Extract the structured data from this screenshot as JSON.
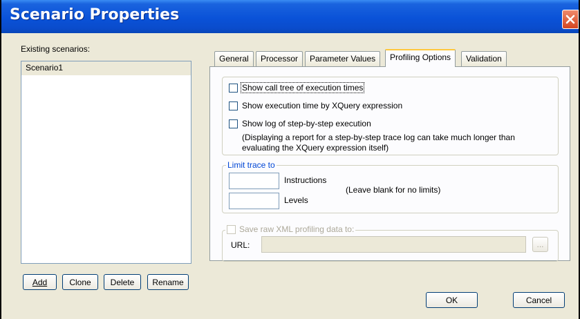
{
  "window": {
    "title": "Scenario Properties"
  },
  "scenarios": {
    "label": "Existing scenarios:",
    "items": [
      "Scenario1"
    ],
    "buttons": {
      "add": "Add",
      "clone": "Clone",
      "delete": "Delete",
      "rename": "Rename"
    }
  },
  "tabs": [
    "General",
    "Processor",
    "Parameter Values",
    "Profiling Options",
    "Validation"
  ],
  "active_tab": "Profiling Options",
  "profiling": {
    "show_call_tree": "Show call tree of execution times",
    "show_execution_time": "Show execution time by XQuery expression",
    "show_log": "Show log of step-by-step execution",
    "log_note_line1": "(Displaying a report for a step-by-step trace log can take much longer than",
    "log_note_line2": "evaluating the XQuery expression itself)",
    "limit_trace": {
      "legend": "Limit trace to",
      "instructions_label": "Instructions",
      "levels_label": "Levels",
      "hint": "(Leave blank for no limits)",
      "instructions_value": "",
      "levels_value": ""
    },
    "save_raw": {
      "label": "Save raw XML profiling data to:",
      "url_label": "URL:",
      "url_value": "",
      "browse_label": "..."
    }
  },
  "footer": {
    "ok": "OK",
    "cancel": "Cancel"
  },
  "colors": {
    "titlebar": "#0a52d8",
    "dialog_bg": "#ece9d8",
    "active_tab_accent": "#ffc83c",
    "close_button": "#d24520"
  }
}
